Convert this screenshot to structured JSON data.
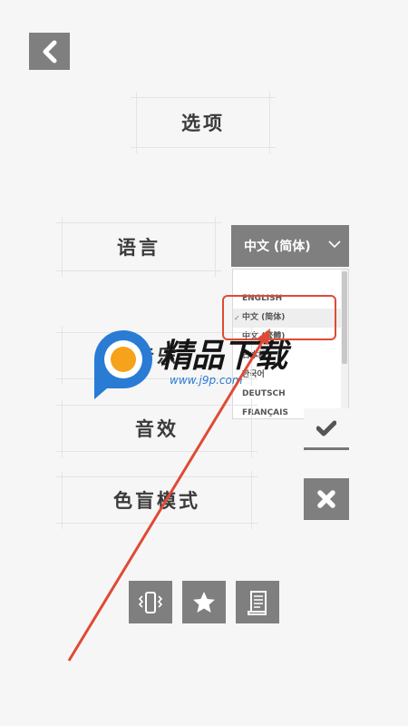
{
  "header": {
    "back_icon": "chevron-left-icon",
    "title": "选项"
  },
  "settings": {
    "language_label": "语言",
    "language_value": "中文 (简体)",
    "language_options": [
      "ENGLISH",
      "中文 (简体)",
      "中文 (繁體)",
      "日本語",
      "한국어",
      "DEUTSCH",
      "FRANÇAIS"
    ],
    "language_selected_index": 1,
    "music_label": "音乐",
    "sfx_label": "音效",
    "sfx_state": "on",
    "colorblind_label": "色盲模式",
    "colorblind_state": "off"
  },
  "bottom_buttons": [
    "vibrate-icon",
    "star-icon",
    "scroll-icon"
  ],
  "watermark": {
    "text": "精品下载",
    "url": "www.j9p.com"
  },
  "colors": {
    "button_gray": "#7f7f7f",
    "background": "#f6f6f6",
    "annotation_red": "#e04a35",
    "watermark_blue": "#2a7bd4",
    "watermark_orange": "#f7a21b"
  }
}
